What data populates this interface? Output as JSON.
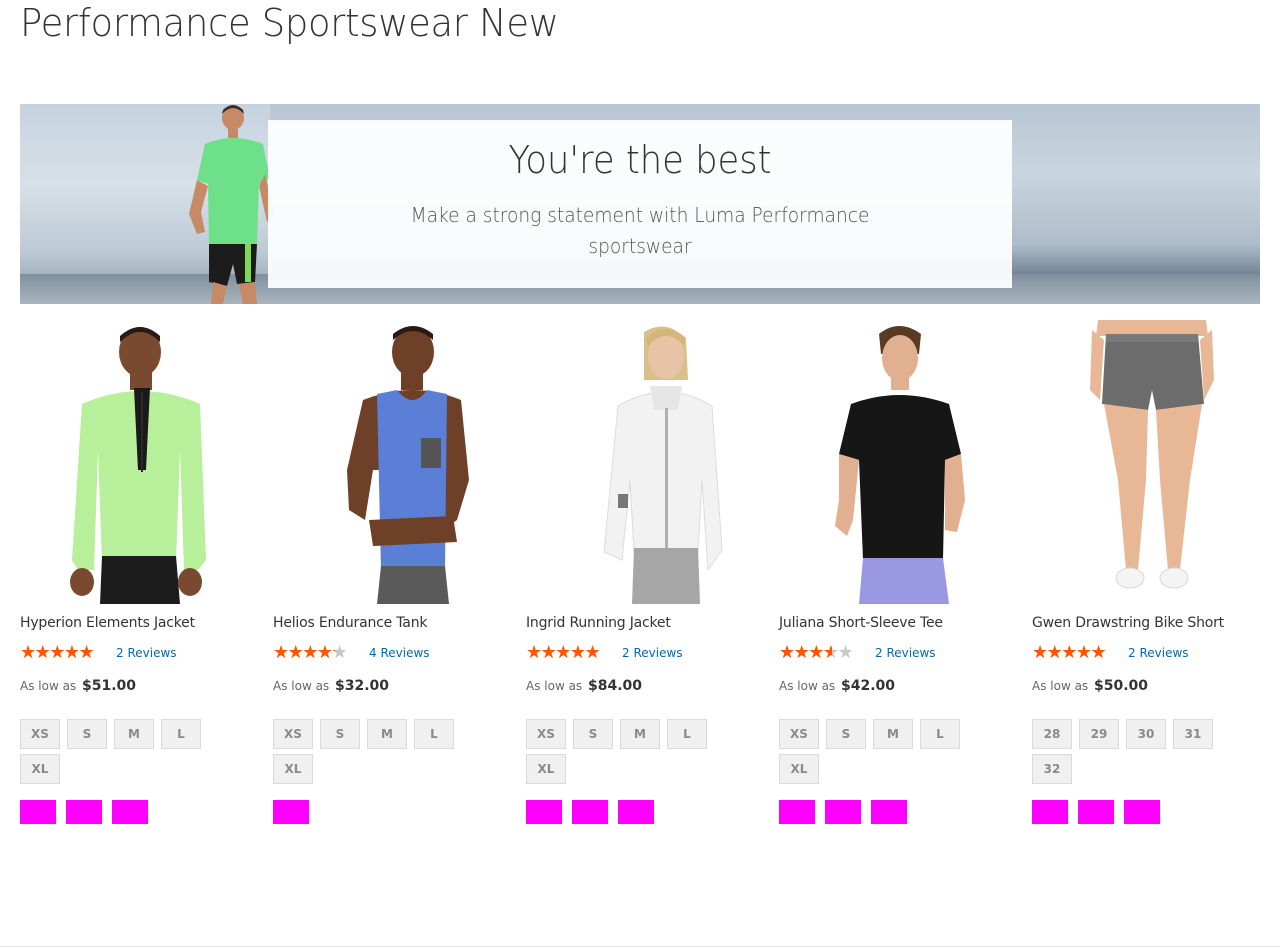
{
  "page": {
    "title": "Performance Sportswear New"
  },
  "banner": {
    "title": "You're the best",
    "subtitle": "Make a strong statement with Luma Performance sportswear"
  },
  "products": [
    {
      "name": "Hyperion Elements Jacket",
      "rating_percent": 90,
      "reviews": "2 Reviews",
      "price_label": "As low as",
      "price": "$51.00",
      "sizes": [
        "XS",
        "S",
        "M",
        "L",
        "XL"
      ],
      "swatch_color": "#ff00ff",
      "swatch_count": 3
    },
    {
      "name": "Helios Endurance Tank",
      "rating_percent": 70,
      "reviews": "4 Reviews",
      "price_label": "As low as",
      "price": "$32.00",
      "sizes": [
        "XS",
        "S",
        "M",
        "L",
        "XL"
      ],
      "swatch_color": "#ff00ff",
      "swatch_count": 1
    },
    {
      "name": "Ingrid Running Jacket",
      "rating_percent": 90,
      "reviews": "2 Reviews",
      "price_label": "As low as",
      "price": "$84.00",
      "sizes": [
        "XS",
        "S",
        "M",
        "L",
        "XL"
      ],
      "swatch_color": "#ff00ff",
      "swatch_count": 3
    },
    {
      "name": "Juliana Short-Sleeve Tee",
      "rating_percent": 60,
      "reviews": "2 Reviews",
      "price_label": "As low as",
      "price": "$42.00",
      "sizes": [
        "XS",
        "S",
        "M",
        "L",
        "XL"
      ],
      "swatch_color": "#ff00ff",
      "swatch_count": 3
    },
    {
      "name": "Gwen Drawstring Bike Short",
      "rating_percent": 90,
      "reviews": "2 Reviews",
      "price_label": "As low as",
      "price": "$50.00",
      "sizes": [
        "28",
        "29",
        "30",
        "31",
        "32"
      ],
      "swatch_color": "#ff00ff",
      "swatch_count": 3
    }
  ],
  "colors": {
    "star_active": "#ff5501",
    "star_inactive": "#c7c7c7",
    "link": "#006bb4",
    "swatch": "#ff00ff"
  }
}
